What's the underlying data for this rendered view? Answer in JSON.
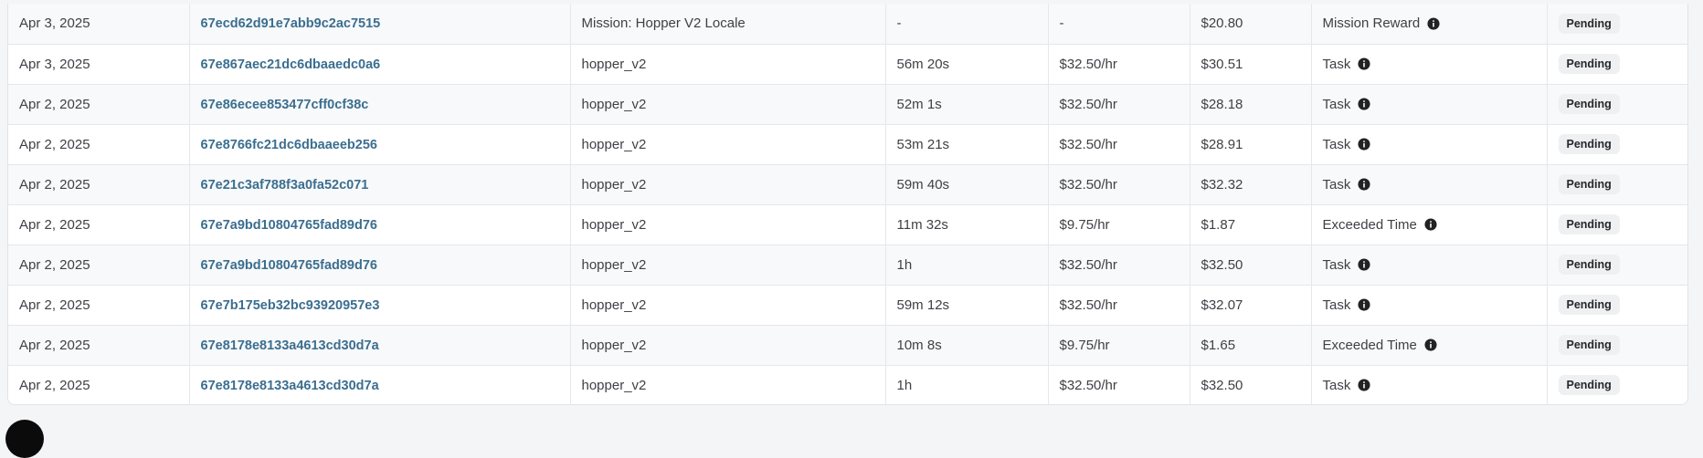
{
  "status_badge_color": "#eef0f2",
  "link_color": "#3b6e8f",
  "rows": [
    {
      "date": "Apr 3, 2025",
      "task_id": "67ecd62d91e7abb9c2ac7515",
      "project": "Mission: Hopper V2 Locale",
      "duration": "-",
      "rate": "-",
      "amount": "$20.80",
      "type": "Mission Reward",
      "status": "Pending"
    },
    {
      "date": "Apr 3, 2025",
      "task_id": "67e867aec21dc6dbaaedc0a6",
      "project": "hopper_v2",
      "duration": "56m 20s",
      "rate": "$32.50/hr",
      "amount": "$30.51",
      "type": "Task",
      "status": "Pending"
    },
    {
      "date": "Apr 2, 2025",
      "task_id": "67e86ecee853477cff0cf38c",
      "project": "hopper_v2",
      "duration": "52m 1s",
      "rate": "$32.50/hr",
      "amount": "$28.18",
      "type": "Task",
      "status": "Pending"
    },
    {
      "date": "Apr 2, 2025",
      "task_id": "67e8766fc21dc6dbaaeeb256",
      "project": "hopper_v2",
      "duration": "53m 21s",
      "rate": "$32.50/hr",
      "amount": "$28.91",
      "type": "Task",
      "status": "Pending"
    },
    {
      "date": "Apr 2, 2025",
      "task_id": "67e21c3af788f3a0fa52c071",
      "project": "hopper_v2",
      "duration": "59m 40s",
      "rate": "$32.50/hr",
      "amount": "$32.32",
      "type": "Task",
      "status": "Pending"
    },
    {
      "date": "Apr 2, 2025",
      "task_id": "67e7a9bd10804765fad89d76",
      "project": "hopper_v2",
      "duration": "11m 32s",
      "rate": "$9.75/hr",
      "amount": "$1.87",
      "type": "Exceeded Time",
      "status": "Pending"
    },
    {
      "date": "Apr 2, 2025",
      "task_id": "67e7a9bd10804765fad89d76",
      "project": "hopper_v2",
      "duration": "1h",
      "rate": "$32.50/hr",
      "amount": "$32.50",
      "type": "Task",
      "status": "Pending"
    },
    {
      "date": "Apr 2, 2025",
      "task_id": "67e7b175eb32bc93920957e3",
      "project": "hopper_v2",
      "duration": "59m 12s",
      "rate": "$32.50/hr",
      "amount": "$32.07",
      "type": "Task",
      "status": "Pending"
    },
    {
      "date": "Apr 2, 2025",
      "task_id": "67e8178e8133a4613cd30d7a",
      "project": "hopper_v2",
      "duration": "10m 8s",
      "rate": "$9.75/hr",
      "amount": "$1.65",
      "type": "Exceeded Time",
      "status": "Pending"
    },
    {
      "date": "Apr 2, 2025",
      "task_id": "67e8178e8133a4613cd30d7a",
      "project": "hopper_v2",
      "duration": "1h",
      "rate": "$32.50/hr",
      "amount": "$32.50",
      "type": "Task",
      "status": "Pending"
    }
  ]
}
